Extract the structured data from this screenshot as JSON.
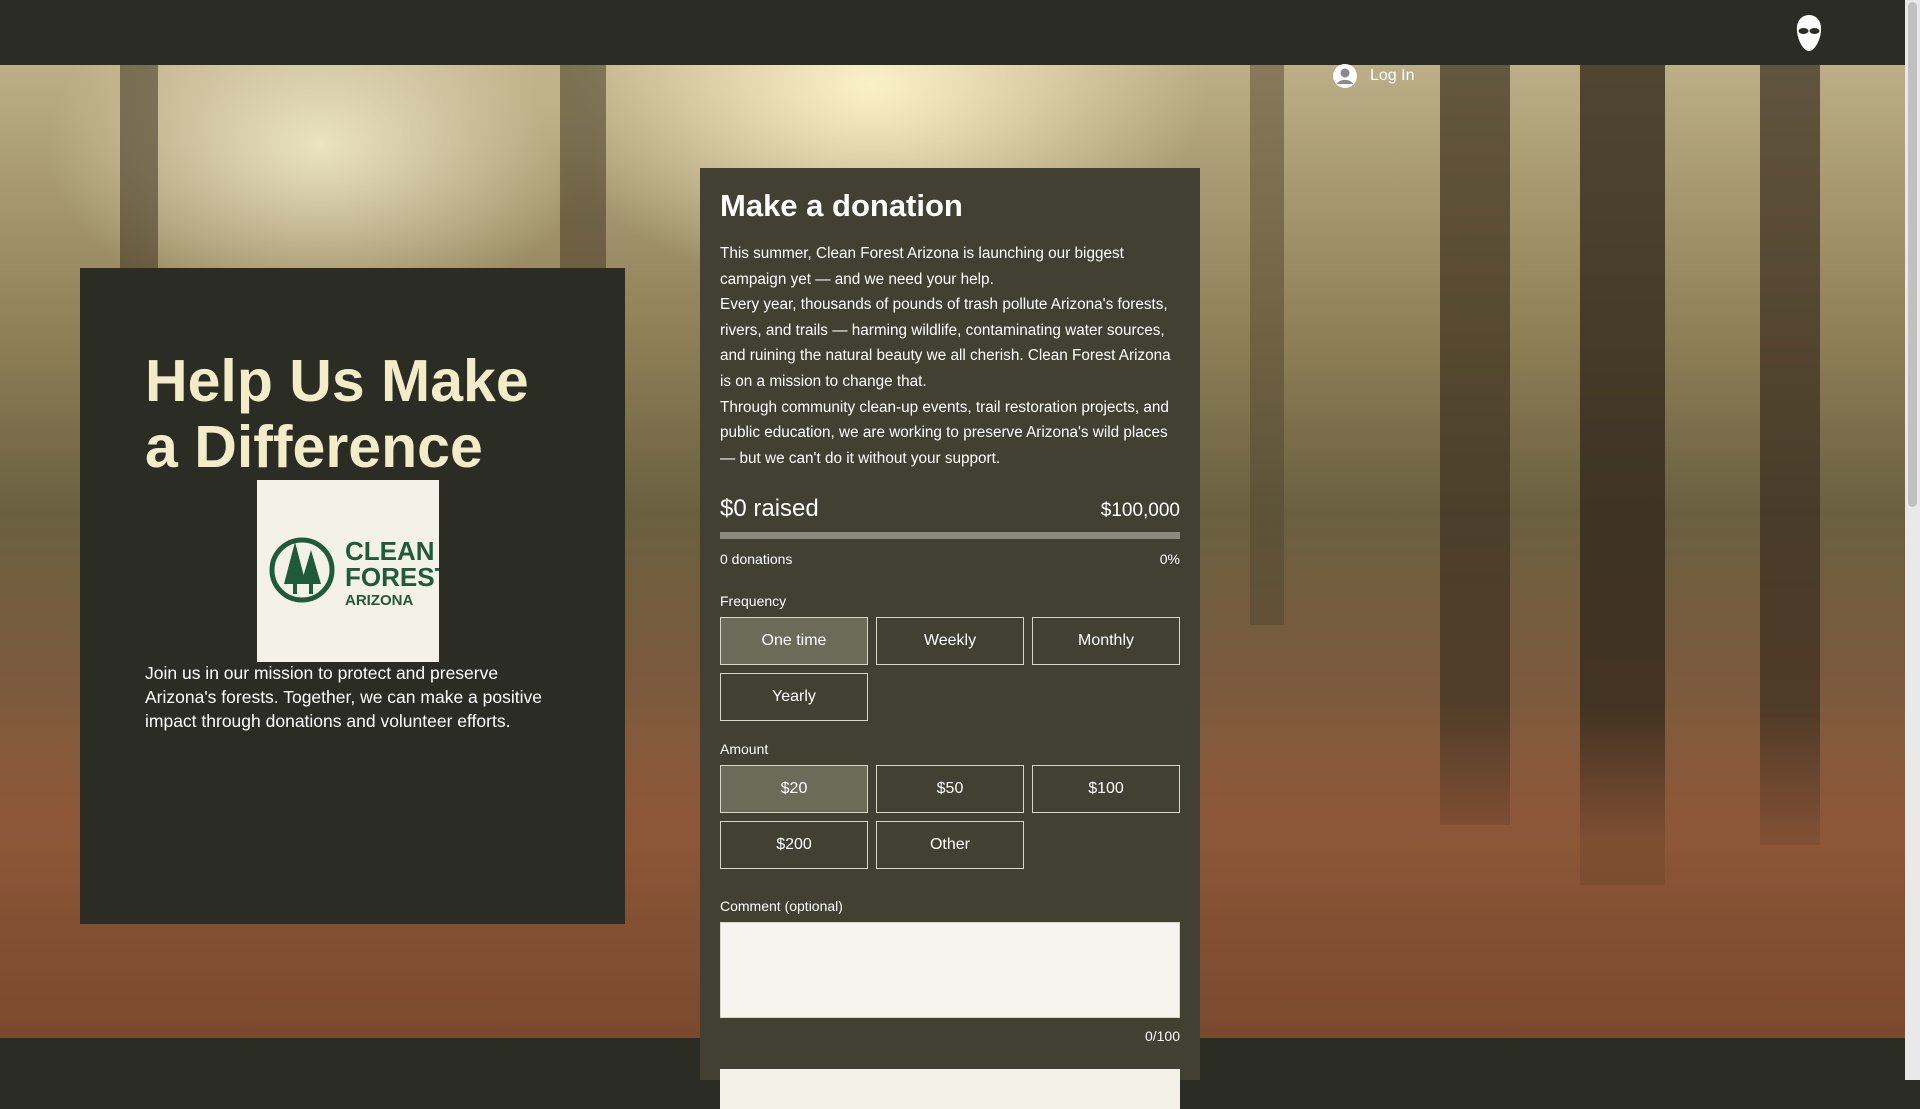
{
  "header": {
    "login_label": "Log In"
  },
  "hero": {
    "title": "Help Us Make a Difference",
    "logo": {
      "line1": "CLEAN",
      "line2": "FOREST",
      "line3": "ARIZONA",
      "color": "#1f5b3a"
    },
    "text": "Join us in our mission to protect and preserve Arizona's forests. Together, we can make a positive impact through donations and volunteer efforts."
  },
  "donation": {
    "title": "Make a donation",
    "description": [
      "This summer, Clean Forest Arizona is launching our biggest campaign yet — and we need your help.",
      "Every year, thousands of pounds of trash pollute Arizona's forests, rivers, and trails — harming wildlife, contaminating water sources, and ruining the natural beauty we all cherish. Clean Forest Arizona is on a mission to change that.",
      "Through community clean-up events, trail restoration projects, and public education, we are working to preserve Arizona's wild places — but we can't do it without your support."
    ],
    "raised": "$0 raised",
    "goal": "$100,000",
    "progress_fraction": 0,
    "donations_count": "0 donations",
    "percent": "0%",
    "frequency_label": "Frequency",
    "frequency_options": [
      "One time",
      "Weekly",
      "Monthly",
      "Yearly"
    ],
    "frequency_selected": "One time",
    "amount_label": "Amount",
    "amount_options": [
      "$20",
      "$50",
      "$100",
      "$200",
      "Other"
    ],
    "amount_selected": "$20",
    "comment_label": "Comment (optional)",
    "comment_value": "",
    "comment_counter": "0/100"
  },
  "colors": {
    "panel": "#2b2c24",
    "card": "#414033",
    "accent": "#f2ecc9"
  }
}
